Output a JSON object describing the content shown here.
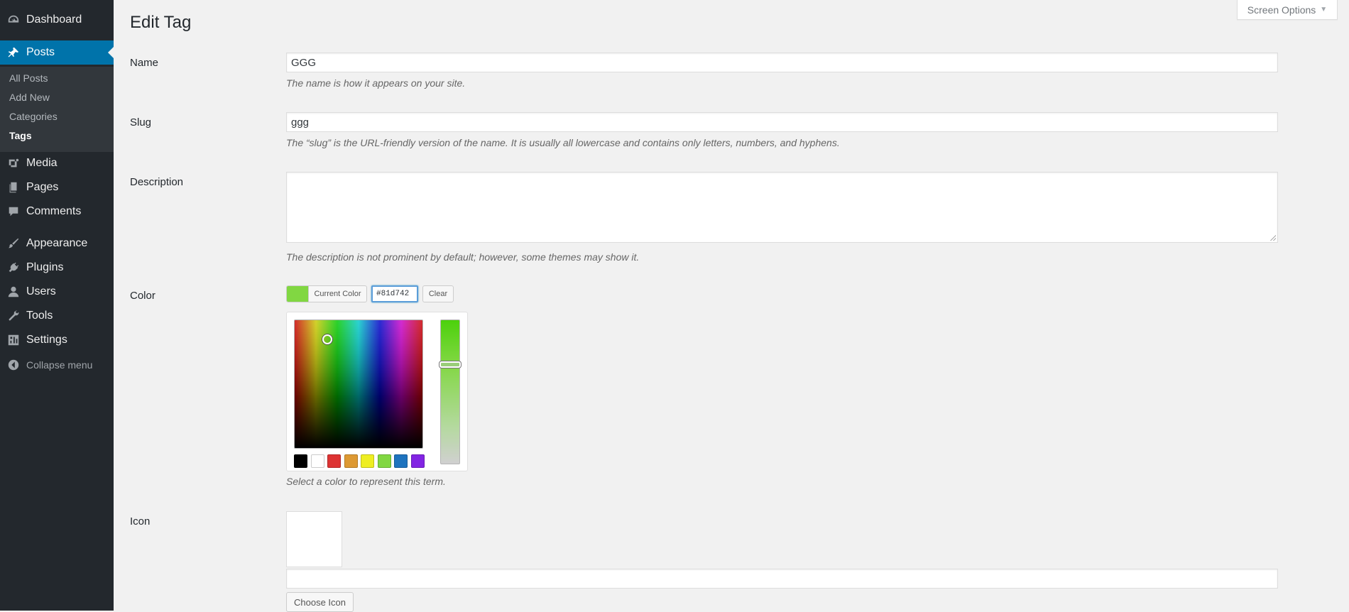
{
  "sidebar": {
    "items": [
      {
        "label": "Dashboard",
        "icon": "dashboard-icon"
      },
      {
        "label": "Posts",
        "icon": "pin-icon"
      },
      {
        "label": "Media",
        "icon": "media-icon"
      },
      {
        "label": "Pages",
        "icon": "pages-icon"
      },
      {
        "label": "Comments",
        "icon": "comments-icon"
      },
      {
        "label": "Appearance",
        "icon": "brush-icon"
      },
      {
        "label": "Plugins",
        "icon": "plug-icon"
      },
      {
        "label": "Users",
        "icon": "user-icon"
      },
      {
        "label": "Tools",
        "icon": "wrench-icon"
      },
      {
        "label": "Settings",
        "icon": "settings-icon"
      }
    ],
    "submenu": [
      "All Posts",
      "Add New",
      "Categories",
      "Tags"
    ],
    "collapse_label": "Collapse menu"
  },
  "screen_options": {
    "label": "Screen Options",
    "caret": "▼"
  },
  "page": {
    "title": "Edit Tag"
  },
  "form": {
    "name": {
      "label": "Name",
      "value": "GGG",
      "description": "The name is how it appears on your site."
    },
    "slug": {
      "label": "Slug",
      "value": "ggg",
      "description": "The “slug” is the URL-friendly version of the name. It is usually all lowercase and contains only letters, numbers, and hyphens."
    },
    "description": {
      "label": "Description",
      "value": "",
      "description": "The description is not prominent by default; however, some themes may show it."
    },
    "color": {
      "label": "Color",
      "current_color_label": "Current Color",
      "current_color": "#81d742",
      "hex_value": "#81d742",
      "clear_label": "Clear",
      "palette": [
        "#000000",
        "#ffffff",
        "#dd3333",
        "#dd9933",
        "#eeee22",
        "#81d742",
        "#1e73be",
        "#8224e3"
      ],
      "description": "Select a color to represent this term."
    },
    "icon": {
      "label": "Icon",
      "value": "",
      "choose_label": "Choose Icon"
    }
  }
}
